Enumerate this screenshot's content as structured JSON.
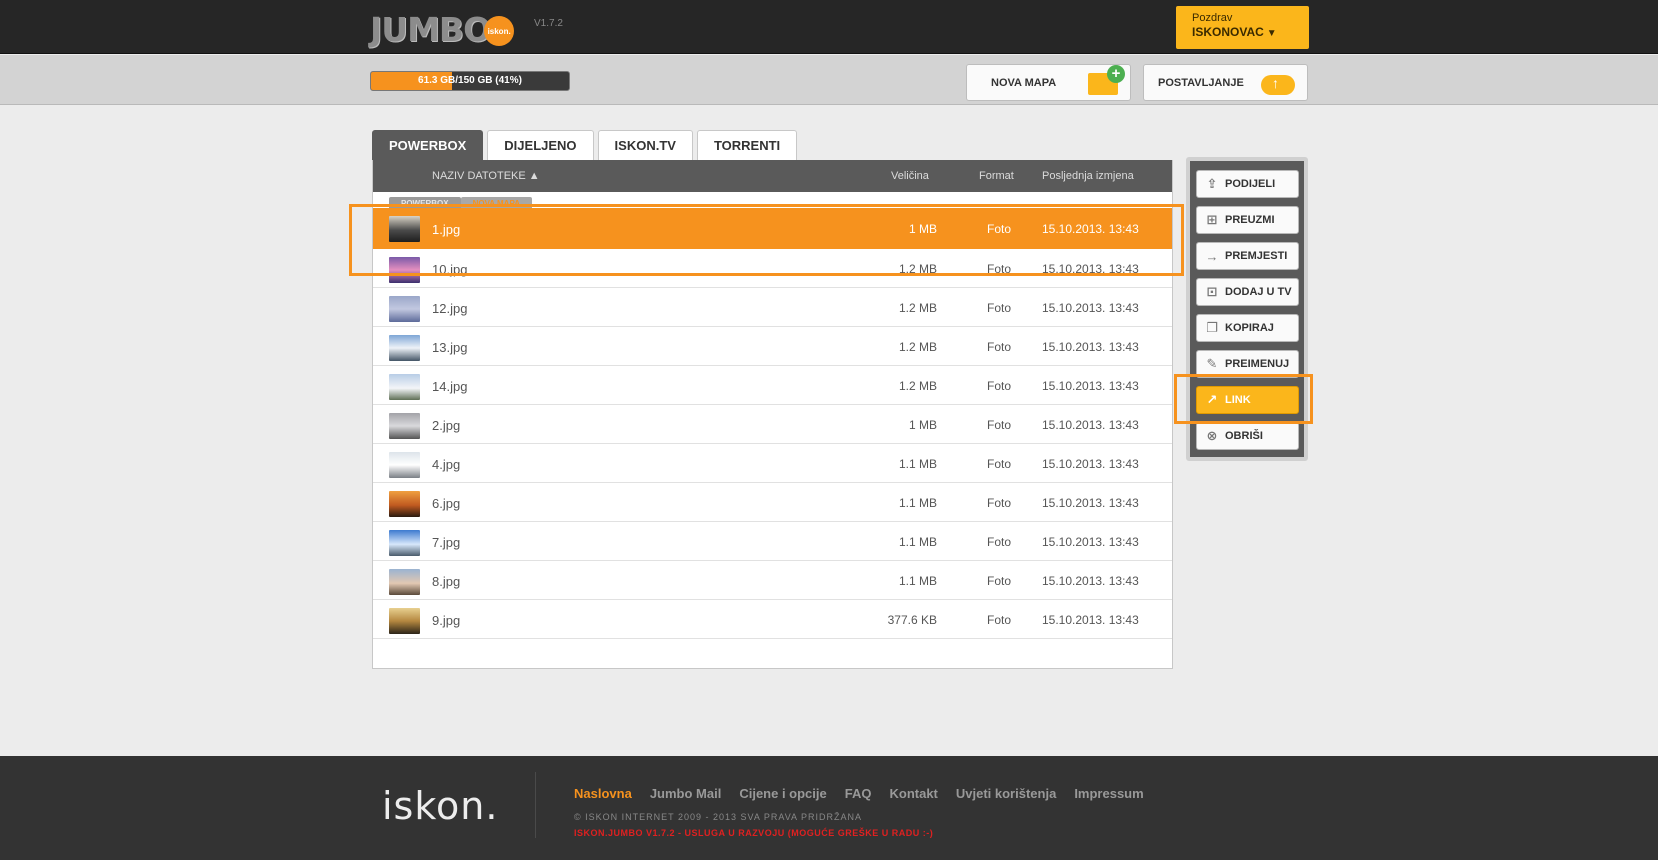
{
  "header": {
    "logo_text": "JUMBO",
    "logo_badge": "iskon.",
    "version": "V1.7.2",
    "greeting": "Pozdrav",
    "username": "ISKONOVAC"
  },
  "toolbar": {
    "quota_label": "61.3 GB/150 GB (41%)",
    "quota_fraction": 0.41,
    "new_folder_label": "NOVA MAPA",
    "upload_label": "POSTAVLJANJE"
  },
  "tabs": [
    {
      "label": "POWERBOX",
      "active": true
    },
    {
      "label": "DIJELJENO",
      "active": false
    },
    {
      "label": "ISKON.TV",
      "active": false
    },
    {
      "label": "TORRENTI",
      "active": false
    }
  ],
  "table": {
    "col_name": "NAZIV DATOTEKE ▲",
    "col_size": "Veličina",
    "col_format": "Format",
    "col_modified": "Posljednja izmjena",
    "breadcrumb": [
      "POWERBOX",
      "NOVA MAPA"
    ],
    "rows": [
      {
        "name": "1.jpg",
        "size": "1 MB",
        "format": "Foto",
        "date": "15.10.2013. 13:43",
        "selected": true
      },
      {
        "name": "10.jpg",
        "size": "1.2 MB",
        "format": "Foto",
        "date": "15.10.2013. 13:43"
      },
      {
        "name": "12.jpg",
        "size": "1.2 MB",
        "format": "Foto",
        "date": "15.10.2013. 13:43"
      },
      {
        "name": "13.jpg",
        "size": "1.2 MB",
        "format": "Foto",
        "date": "15.10.2013. 13:43"
      },
      {
        "name": "14.jpg",
        "size": "1.2 MB",
        "format": "Foto",
        "date": "15.10.2013. 13:43"
      },
      {
        "name": "2.jpg",
        "size": "1 MB",
        "format": "Foto",
        "date": "15.10.2013. 13:43"
      },
      {
        "name": "4.jpg",
        "size": "1.1 MB",
        "format": "Foto",
        "date": "15.10.2013. 13:43"
      },
      {
        "name": "6.jpg",
        "size": "1.1 MB",
        "format": "Foto",
        "date": "15.10.2013. 13:43"
      },
      {
        "name": "7.jpg",
        "size": "1.1 MB",
        "format": "Foto",
        "date": "15.10.2013. 13:43"
      },
      {
        "name": "8.jpg",
        "size": "1.1 MB",
        "format": "Foto",
        "date": "15.10.2013. 13:43"
      },
      {
        "name": "9.jpg",
        "size": "377.6 KB",
        "format": "Foto",
        "date": "15.10.2013. 13:43"
      }
    ]
  },
  "actions": {
    "share": "PODIJELI",
    "download": "PREUZMI",
    "move": "PREMJESTI",
    "add_tv": "DODAJ U TV",
    "copy": "KOPIRAJ",
    "rename": "PREIMENUJ",
    "link": "LINK",
    "delete": "OBRIŠI"
  },
  "footer": {
    "logo": "iskon.",
    "nav": [
      "Naslovna",
      "Jumbo Mail",
      "Cijene i opcije",
      "FAQ",
      "Kontakt",
      "Uvjeti korištenja",
      "Impressum"
    ],
    "copyright": "© ISKON INTERNET 2009 - 2013 SVA PRAVA PRIDRŽANA",
    "dev_notice": "ISKON.JUMBO V1.7.2 - USLUGA U RAZVOJU (MOGUĆE GREŠKE U RADU :-)"
  },
  "colors": {
    "accent": "#f6921e",
    "button_yellow": "#fbb61b",
    "header_dark": "#262626",
    "table_head": "#5a5a5a"
  }
}
